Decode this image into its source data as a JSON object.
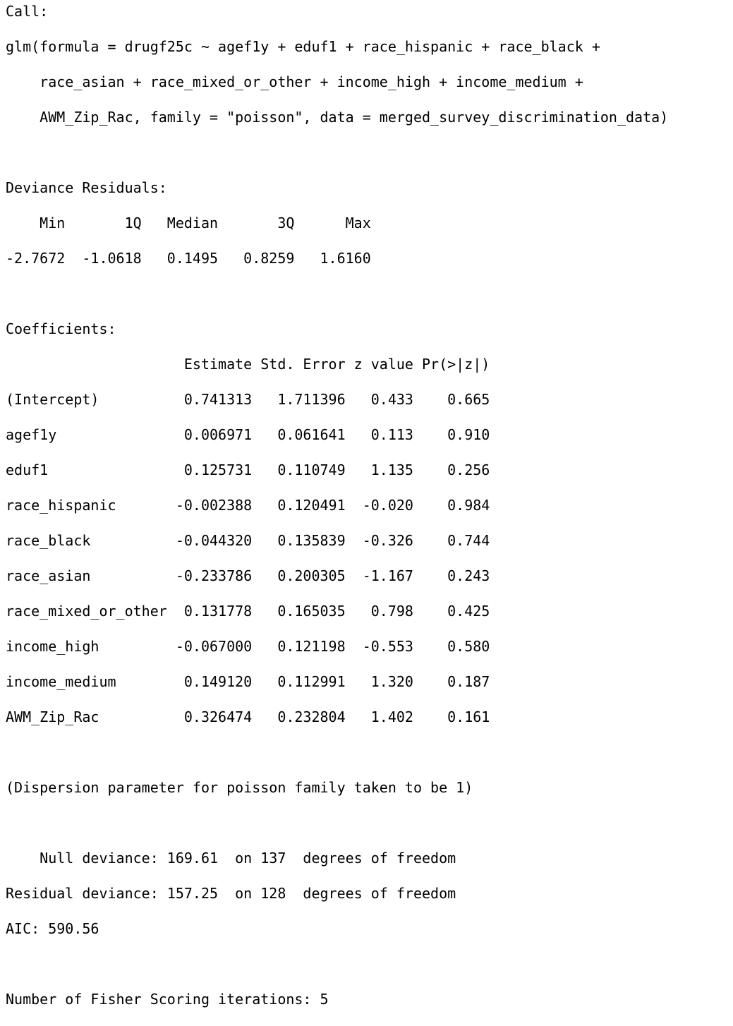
{
  "console": {
    "lines": [
      "Call:",
      "glm(formula = drugf25c ~ agef1y + eduf1 + race_hispanic + race_black + ",
      "    race_asian + race_mixed_or_other + income_high + income_medium + ",
      "    AWM_Zip_Rac, family = \"poisson\", data = merged_survey_discrimination_data)",
      "",
      "Deviance Residuals: ",
      "    Min       1Q   Median       3Q      Max  ",
      "-2.7672  -1.0618   0.1495   0.8259   1.6160  ",
      "",
      "Coefficients:",
      "                     Estimate Std. Error z value Pr(>|z|)",
      "(Intercept)          0.741313   1.711396   0.433    0.665",
      "agef1y               0.006971   0.061641   0.113    0.910",
      "eduf1                0.125731   0.110749   1.135    0.256",
      "race_hispanic       -0.002388   0.120491  -0.020    0.984",
      "race_black          -0.044320   0.135839  -0.326    0.744",
      "race_asian          -0.233786   0.200305  -1.167    0.243",
      "race_mixed_or_other  0.131778   0.165035   0.798    0.425",
      "income_high         -0.067000   0.121198  -0.553    0.580",
      "income_medium        0.149120   0.112991   1.320    0.187",
      "AWM_Zip_Rac          0.326474   0.232804   1.402    0.161",
      "",
      "(Dispersion parameter for poisson family taken to be 1)",
      "",
      "    Null deviance: 169.61  on 137  degrees of freedom",
      "Residual deviance: 157.25  on 128  degrees of freedom",
      "AIC: 590.56",
      "",
      "Number of Fisher Scoring iterations: 5"
    ]
  }
}
